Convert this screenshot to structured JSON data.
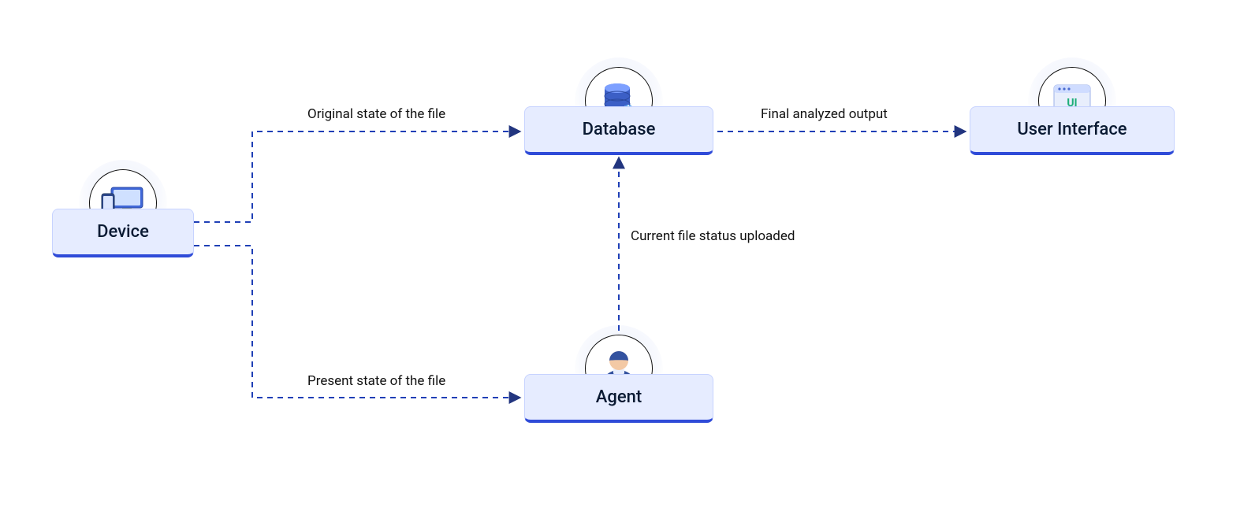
{
  "nodes": {
    "device": {
      "label": "Device"
    },
    "database": {
      "label": "Database"
    },
    "agent": {
      "label": "Agent"
    },
    "ui": {
      "label": "User Interface"
    }
  },
  "edges": {
    "device_to_db": {
      "label": "Original state of the file"
    },
    "device_to_agent": {
      "label": "Present state of the file"
    },
    "agent_to_db": {
      "label": "Current file status uploaded"
    },
    "db_to_ui": {
      "label": "Final analyzed output"
    }
  },
  "colors": {
    "card_fill": "#e6ecff",
    "card_border": "#c7d3ff",
    "card_accent": "#2f4bd8",
    "line": "#1f3fb6",
    "arrow": "#22357f"
  },
  "ui_icon_text": "UI"
}
